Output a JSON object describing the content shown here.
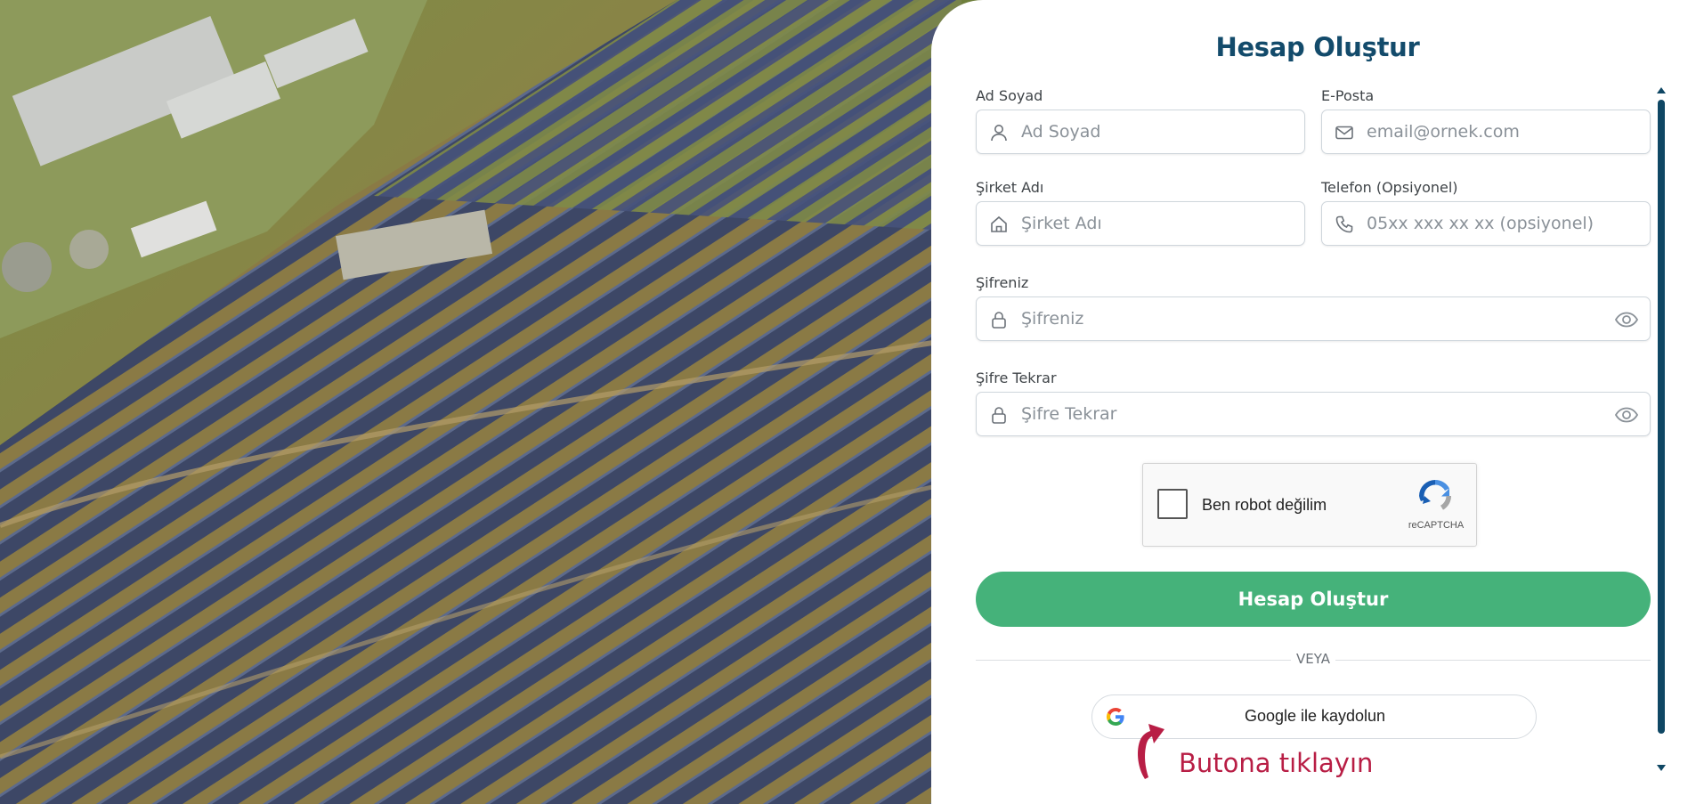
{
  "form": {
    "title": "Hesap Oluştur",
    "fields": {
      "full_name": {
        "label": "Ad Soyad",
        "placeholder": "Ad Soyad",
        "icon": "user-icon"
      },
      "email": {
        "label": "E-Posta",
        "placeholder": "email@ornek.com",
        "icon": "mail-icon"
      },
      "company": {
        "label": "Şirket Adı",
        "placeholder": "Şirket Adı",
        "icon": "home-icon"
      },
      "phone": {
        "label": "Telefon (Opsiyonel)",
        "placeholder": "05xx xxx xx xx (opsiyonel)",
        "icon": "phone-icon"
      },
      "password": {
        "label": "Şifreniz",
        "placeholder": "Şifreniz",
        "icon": "lock-icon"
      },
      "password_repeat": {
        "label": "Şifre Tekrar",
        "placeholder": "Şifre Tekrar",
        "icon": "lock-icon"
      }
    },
    "captcha": {
      "label": "Ben robot değilim",
      "brand": "reCAPTCHA"
    },
    "submit_label": "Hesap Oluştur",
    "divider_label": "VEYA",
    "google_label": "Google ile kaydolun",
    "hint": "Butona tıklayın"
  },
  "colors": {
    "title": "#134b6b",
    "primary_button": "#45b27a",
    "hint": "#b81e45",
    "scrollbar": "#0f4764"
  }
}
